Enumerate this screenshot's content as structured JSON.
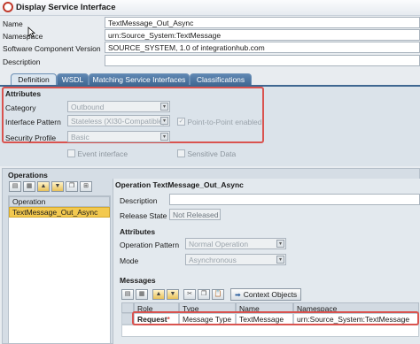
{
  "window": {
    "title": "Display Service Interface"
  },
  "header": {
    "name_label": "Name",
    "name_value": "TextMessage_Out_Async",
    "namespace_label": "Namespace",
    "namespace_value": "urn:Source_System:TextMessage",
    "swcv_label": "Software Component Version",
    "swcv_value": "SOURCE_SYSTEM, 1.0 of integrationhub.com",
    "description_label": "Description",
    "description_value": ""
  },
  "tabs": [
    "Definition",
    "WSDL",
    "Matching Service Interfaces",
    "Classifications"
  ],
  "attributes": {
    "heading": "Attributes",
    "category_label": "Category",
    "category_value": "Outbound",
    "pattern_label": "Interface Pattern",
    "pattern_value": "Stateless (XI30-Compatible)",
    "p2p_label": "Point-to-Point enabled",
    "security_label": "Security Profile",
    "security_value": "Basic",
    "event_label": "Event interface",
    "sensitive_label": "Sensitive Data"
  },
  "operations": {
    "heading": "Operations",
    "list_header": "Operation",
    "items": [
      "TextMessage_Out_Async"
    ]
  },
  "operation_detail": {
    "title": "Operation TextMessage_Out_Async",
    "description_label": "Description",
    "description_value": "",
    "release_label": "Release State",
    "release_value": "Not Released",
    "attributes_heading": "Attributes",
    "op_pattern_label": "Operation Pattern",
    "op_pattern_value": "Normal Operation",
    "mode_label": "Mode",
    "mode_value": "Asynchronous"
  },
  "messages": {
    "heading": "Messages",
    "context_button": "Context Objects",
    "columns": [
      "Role",
      "Type",
      "Name",
      "Namespace"
    ],
    "rows": [
      {
        "role": "Request",
        "required": "*",
        "type": "Message Type",
        "name": "TextMessage",
        "namespace": "urn:Source_System:TextMessage"
      }
    ]
  },
  "colors": {
    "highlight": "#d9534f",
    "tab_blue": "#3f6791",
    "selected_row": "#f3c94f"
  }
}
